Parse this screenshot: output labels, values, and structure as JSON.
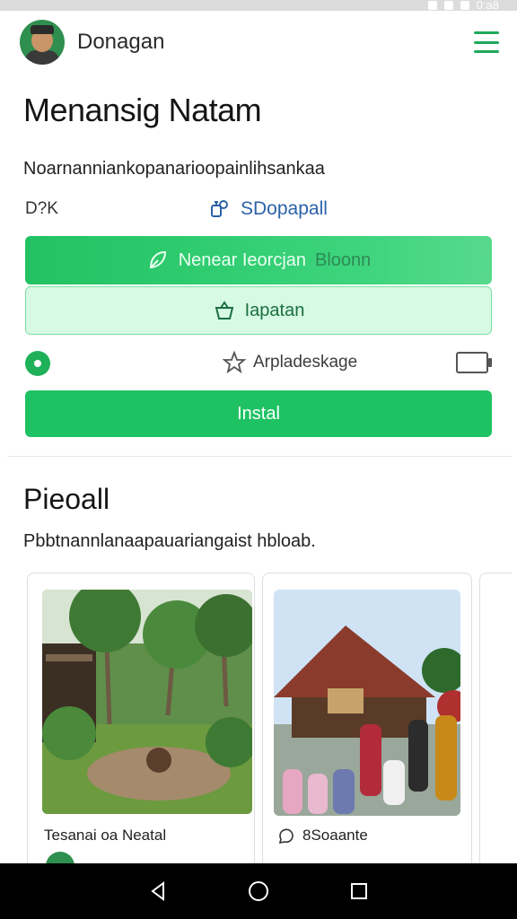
{
  "status_bar": {
    "time": "0:a8"
  },
  "header": {
    "title": "Donagan"
  },
  "main": {
    "heading": "Menansig Natam",
    "description": "Noarnanniankopanarioopainlihsankaa",
    "meta_label": "D?K",
    "link_label": "SDopapall",
    "primary_button": {
      "label": "Nenear Ieorcjan",
      "tail": "Bloonn"
    },
    "secondary_button": {
      "label": "Iapatan"
    },
    "rating_label": "Arpladeskage",
    "install_button": "Instal"
  },
  "gallery": {
    "title": "Pieoall",
    "subtitle": "Pbbtnannlanaapauariangaist hbloab.",
    "cards": [
      {
        "caption": "Tesanai oa Neatal"
      },
      {
        "caption": "8Soaante"
      }
    ]
  },
  "colors": {
    "accent": "#1fc263",
    "accent_light": "#d7fae4",
    "link": "#2b62a8"
  }
}
